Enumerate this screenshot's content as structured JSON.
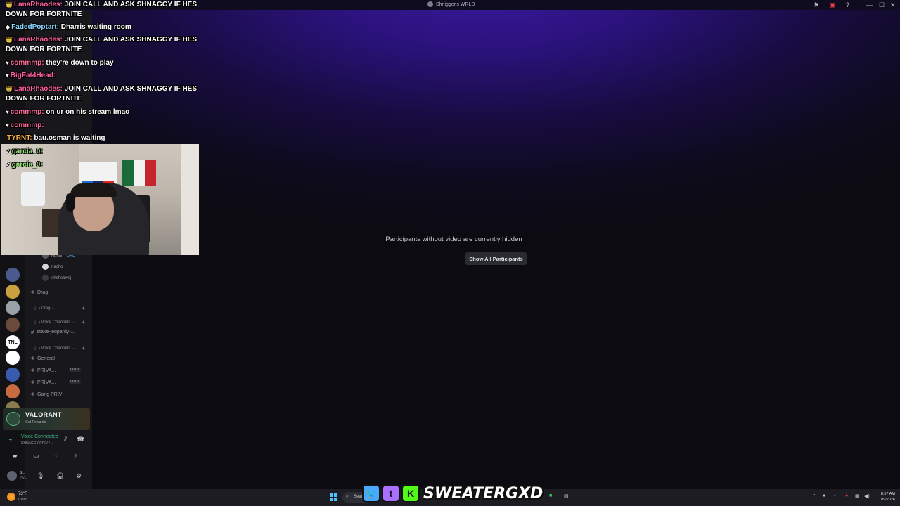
{
  "window": {
    "title": "Shnigger's WRLD",
    "controls": {
      "minimize": "—",
      "maximize": "☐",
      "close": "✕"
    }
  },
  "stage": {
    "hidden_notice": "Participants without video are currently hidden",
    "show_all_label": "Show All Participants"
  },
  "sidebar": {
    "members": [
      {
        "name": "Adrian",
        "tag": "GXD"
      },
      {
        "name": "nacho"
      },
      {
        "name": "ohsheluvsj"
      }
    ],
    "channels": [
      {
        "label": "Drag",
        "icon": "speaker-icon"
      },
      {
        "label": "Drag",
        "type": "category"
      },
      {
        "label": "Voice Channels",
        "type": "category"
      },
      {
        "label": "stake-jeopardy-...",
        "icon": "hash-icon"
      },
      {
        "label": "Voice Channels",
        "type": "category"
      },
      {
        "label": "General",
        "icon": "speaker-icon"
      },
      {
        "label": "PRIVA...",
        "icon": "speaker-icon",
        "pill": "00 03"
      },
      {
        "label": "PRIVA...",
        "icon": "speaker-icon",
        "pill": "00 03"
      },
      {
        "label": "Gang PRIV",
        "icon": "speaker-icon"
      }
    ],
    "guild_colors": [
      "#4a5a8c",
      "#c8a040",
      "#9aa0a8",
      "#6a4a3a",
      "#ffffff",
      "#3a5ab0",
      "#c86a40",
      "#8a7a50"
    ],
    "guild_label_tnl": "TNL"
  },
  "promo": {
    "title": "VALORANT",
    "subtitle": "Get Rewards!"
  },
  "voice": {
    "status": "Voice Connected",
    "channel": "SHNAGGY PRIV / ..."
  },
  "user": {
    "name": "S...",
    "status": "Inv..."
  },
  "chat": [
    {
      "user": "LanaRhaodes:",
      "text": "JOIN CALL AND ASK SHNAGGY IF HES DOWN FOR FORTNITE",
      "color": "#ff5fa2",
      "badge": "👑"
    },
    {
      "user": "FadedPoptart:",
      "text": "Dharris waiting room",
      "color": "#8ad6ff",
      "badge": "◆"
    },
    {
      "user": "LanaRhaodes:",
      "text": "JOIN CALL AND ASK SHNAGGY IF HES DOWN FOR FORTNITE",
      "color": "#ff5fa2",
      "badge": "👑"
    },
    {
      "user": "commmp:",
      "text": "they're down to play",
      "color": "#ff6b9a",
      "badge": "♥"
    },
    {
      "user": "BigFat4Head:",
      "text": "",
      "color": "#ff5fa2",
      "badge": "♥"
    },
    {
      "user": "LanaRhaodes:",
      "text": "JOIN CALL AND ASK SHNAGGY IF HES DOWN FOR FORTNITE",
      "color": "#ff5fa2",
      "badge": "👑"
    },
    {
      "user": "commmp:",
      "text": "on ur on his stream lmao",
      "color": "#ff6b9a",
      "badge": "♥"
    },
    {
      "user": "commmp:",
      "text": "",
      "color": "#ff6b9a",
      "badge": "♥"
    },
    {
      "user": "TYRNT:",
      "text": "bau.osman is waiting",
      "color": "#ffb347",
      "badge": ""
    },
    {
      "user": "garcia_0:",
      "text": "",
      "color": "#9ae07a",
      "badge": "✓"
    },
    {
      "user": "garcia_0:",
      "text": "",
      "color": "#9ae07a",
      "badge": "✓"
    }
  ],
  "taskbar": {
    "weather_temp": "73°F",
    "weather_cond": "Clear",
    "search_label": "Search",
    "time": "8:57 AM",
    "date": "1/9/2026"
  },
  "brand": {
    "name": "SWEATERGXD",
    "twitter": "🐦",
    "twitch": "t",
    "kick": "K"
  },
  "colors": {
    "accent": "#5865f2",
    "voice_green": "#43b581"
  }
}
